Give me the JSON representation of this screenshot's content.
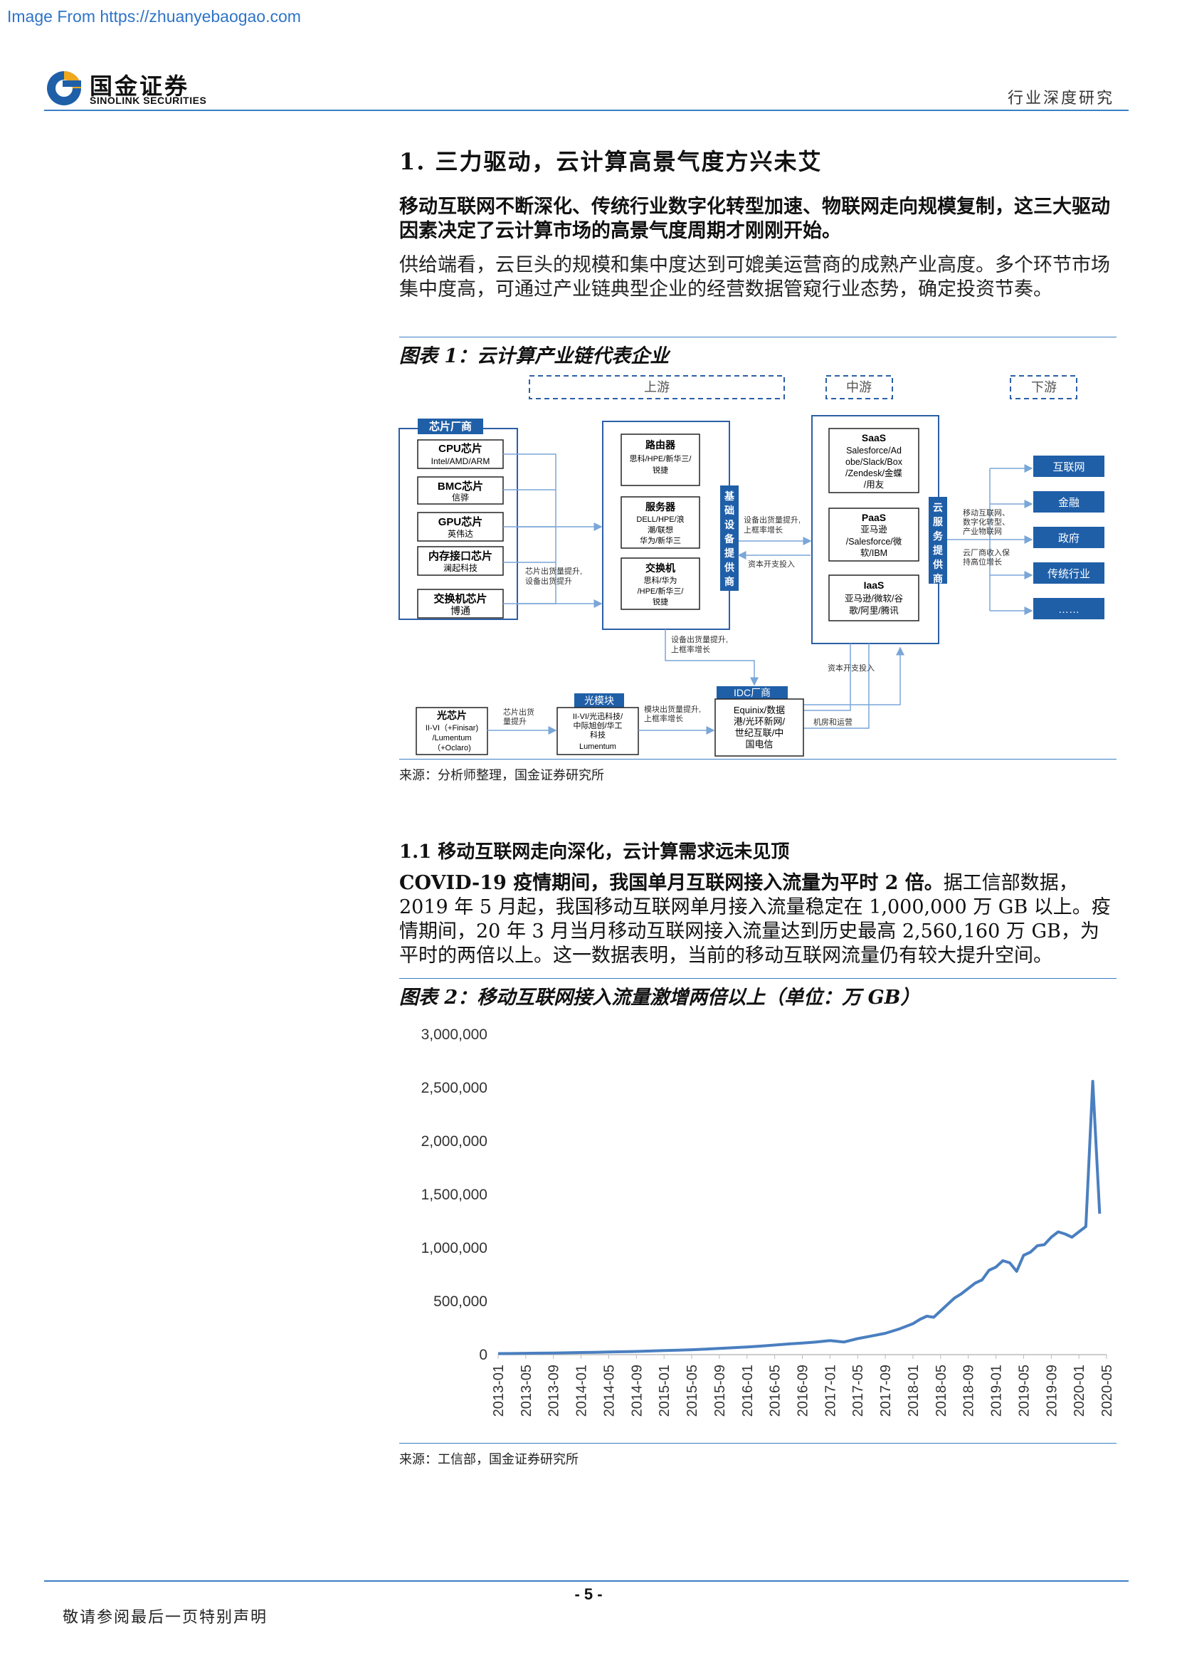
{
  "watermark": "Image From https://zhuanyebaogao.com",
  "header": {
    "logo_cn": "国金证券",
    "logo_en": "SINOLINK SECURITIES",
    "report_type": "行业深度研究"
  },
  "section1": {
    "title": "1.  三力驱动，云计算高景气度方兴未艾",
    "para_bold": "移动互联网不断深化、传统行业数字化转型加速、物联网走向规模复制，这三大驱动因素决定了云计算市场的高景气度周期才刚刚开始。",
    "para": "供给端看，云巨头的规模和集中度达到可媲美运营商的成熟产业高度。多个环节市场集中度高，可通过产业链典型企业的经营数据管窥行业态势，确定投资节奏。"
  },
  "figure1": {
    "title": "图表 1：云计算产业链代表企业",
    "source": "来源：分析师整理，国金证券研究所",
    "stages": {
      "upstream": "上游",
      "midstream": "中游",
      "downstream": "下游"
    },
    "chip_group": "芯片厂商",
    "chips": [
      {
        "name": "CPU芯片",
        "vendors": "Intel/AMD/ARM"
      },
      {
        "name": "BMC芯片",
        "vendors": "信骅"
      },
      {
        "name": "GPU芯片",
        "vendors": "英伟达"
      },
      {
        "name": "内存接口芯片",
        "vendors": "澜起科技"
      },
      {
        "name": "交换机芯片",
        "vendors": "博通"
      }
    ],
    "chip_note": [
      "芯片出货量提升,",
      "设备出货提升"
    ],
    "equipment": [
      {
        "name": "路由器",
        "vendors": [
          "思科/HPE/新华三/",
          "锐捷"
        ]
      },
      {
        "name": "服务器",
        "vendors": [
          "DELL/HPE/浪",
          "潮/联想",
          "华为/新华三"
        ]
      },
      {
        "name": "交换机",
        "vendors": [
          "思科/华为",
          "/HPE/新华三/",
          "锐捷"
        ]
      }
    ],
    "infra_label": [
      "基",
      "础",
      "设",
      "备",
      "提",
      "供",
      "商"
    ],
    "equip_note_a": [
      "设备出货量提升,",
      "上框率增长"
    ],
    "equip_note_b": "资本开支投入",
    "cloud": [
      {
        "name": "SaaS",
        "vendors": [
          "Salesforce/Ad",
          "obe/Slack/Box",
          "/Zendesk/金蝶",
          "/用友"
        ]
      },
      {
        "name": "PaaS",
        "vendors": [
          "亚马逊",
          "/Salesforce/微",
          "软/IBM"
        ]
      },
      {
        "name": "IaaS",
        "vendors": [
          "亚马逊/微软/谷",
          "歌/阿里/腾讯"
        ]
      }
    ],
    "cloud_label": [
      "云",
      "服",
      "务",
      "提",
      "供",
      "商"
    ],
    "cloud_note_a": [
      "移动互联网、",
      "数字化转型、",
      "产业物联网"
    ],
    "cloud_note_b": [
      "云厂商收入保",
      "持高位增长"
    ],
    "downstream_items": [
      "互联网",
      "金融",
      "政府",
      "传统行业",
      "……"
    ],
    "idc_note_a": [
      "设备出货量提升,",
      "上框率增长"
    ],
    "idc_note_b": "资本开支投入",
    "idc_note_c": "机房和运营",
    "optical_chip": {
      "name": "光芯片",
      "vendors": [
        "II-VI（+Finisar)",
        "/Lumentum",
        "（+Oclaro)"
      ]
    },
    "optical_note": [
      "芯片出货",
      "量提升"
    ],
    "optical_module": {
      "title": "光模块",
      "vendors": [
        "II-VI/光迅科技/",
        "中际旭创/华工",
        "科技",
        "Lumentum"
      ]
    },
    "module_note": [
      "模块出货量提升,",
      "上框率增长"
    ],
    "idc": {
      "title": "IDC厂商",
      "vendors": [
        "Equinix/数据",
        "港/光环新网/",
        "世纪互联/中",
        "国电信"
      ]
    }
  },
  "section1_1": {
    "title": "1.1 移动互联网走向深化，云计算需求远未见顶",
    "para_bold": "COVID-19 疫情期间，我国单月互联网接入流量为平时 2 倍。",
    "para": "据工信部数据，2019 年 5 月起，我国移动互联网单月接入流量稳定在 1,000,000 万 GB 以上。疫情期间，20 年 3 月当月移动互联网接入流量达到历史最高 2,560,160 万 GB，为平时的两倍以上。这一数据表明，当前的移动互联网流量仍有较大提升空间。"
  },
  "figure2": {
    "title": "图表 2：移动互联网接入流量激增两倍以上（单位：万 GB）",
    "source": "来源：工信部，国金证券研究所"
  },
  "chart_data": {
    "type": "line",
    "title": "",
    "xlabel": "",
    "ylabel": "",
    "ylim": [
      0,
      3000000
    ],
    "yticks": [
      0,
      500000,
      1000000,
      1500000,
      2000000,
      2500000,
      3000000
    ],
    "ytick_labels": [
      "0",
      "500,000",
      "1,000,000",
      "1,500,000",
      "2,000,000",
      "2,500,000",
      "3,000,000"
    ],
    "xtick_labels": [
      "2013-01",
      "2013-05",
      "2013-09",
      "2014-01",
      "2014-05",
      "2014-09",
      "2015-01",
      "2015-05",
      "2015-09",
      "2016-01",
      "2016-05",
      "2016-09",
      "2017-01",
      "2017-05",
      "2017-09",
      "2018-01",
      "2018-05",
      "2018-09",
      "2019-01",
      "2019-05",
      "2019-09",
      "2020-01",
      "2020-05"
    ],
    "line_color": "#4a7fc0",
    "grid": false,
    "x": [
      "2013-01",
      "2013-03",
      "2013-05",
      "2013-07",
      "2013-09",
      "2013-11",
      "2014-01",
      "2014-03",
      "2014-05",
      "2014-07",
      "2014-09",
      "2014-11",
      "2015-01",
      "2015-03",
      "2015-05",
      "2015-07",
      "2015-09",
      "2015-11",
      "2016-01",
      "2016-03",
      "2016-05",
      "2016-07",
      "2016-09",
      "2016-11",
      "2017-01",
      "2017-03",
      "2017-05",
      "2017-07",
      "2017-09",
      "2017-11",
      "2018-01",
      "2018-02",
      "2018-03",
      "2018-04",
      "2018-05",
      "2018-06",
      "2018-07",
      "2018-08",
      "2018-09",
      "2018-10",
      "2018-11",
      "2018-12",
      "2019-01",
      "2019-02",
      "2019-03",
      "2019-04",
      "2019-05",
      "2019-06",
      "2019-07",
      "2019-08",
      "2019-09",
      "2019-10",
      "2019-11",
      "2019-12",
      "2020-01",
      "2020-02",
      "2020-03",
      "2020-04"
    ],
    "values": [
      10000,
      11000,
      12500,
      14000,
      15500,
      17500,
      20000,
      22000,
      24500,
      27000,
      30000,
      34000,
      38000,
      42000,
      46000,
      52000,
      58000,
      65000,
      72000,
      80000,
      90000,
      100000,
      108000,
      118000,
      132000,
      118000,
      150000,
      175000,
      200000,
      240000,
      290000,
      330000,
      360000,
      350000,
      410000,
      470000,
      530000,
      570000,
      620000,
      670000,
      700000,
      790000,
      820000,
      880000,
      860000,
      780000,
      930000,
      960000,
      1020000,
      1030000,
      1100000,
      1150000,
      1130000,
      1100000,
      1150000,
      1200000,
      2560160,
      1320000
    ]
  },
  "footer": {
    "page": "- 5 -",
    "note": "敬请参阅最后一页特别声明"
  }
}
